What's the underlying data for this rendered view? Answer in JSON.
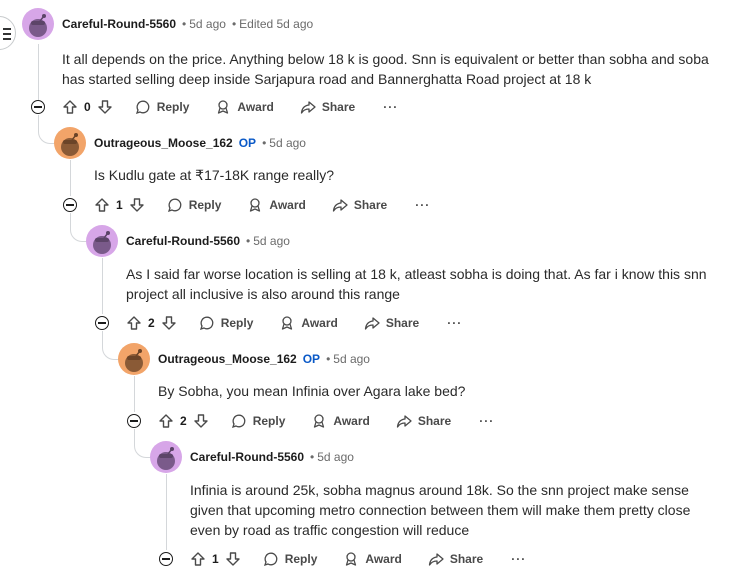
{
  "comments": [
    {
      "author": "Careful-Round-5560",
      "op": false,
      "time": "5d ago",
      "edited": "Edited 5d ago",
      "body": "It all depends on the price. Anything below 18 k is good. Snn is equivalent or better than sobha and soba has started selling deep inside Sarjapura road and Bannerghatta Road project at 18 k",
      "votes": "0",
      "avatar_color": "#d7a6e8"
    },
    {
      "author": "Outrageous_Moose_162",
      "op_label": "OP",
      "time": "5d ago",
      "body": "Is Kudlu gate at ₹17-18K range really?",
      "votes": "1",
      "avatar_color": "#f2a469"
    },
    {
      "author": "Careful-Round-5560",
      "time": "5d ago",
      "body": "As I said far worse location is selling at 18 k, atleast sobha is doing that. As far i know this snn project all inclusive is also around this range",
      "votes": "2",
      "avatar_color": "#d7a6e8"
    },
    {
      "author": "Outrageous_Moose_162",
      "op_label": "OP",
      "time": "5d ago",
      "body": "By Sobha, you mean Infinia over Agara lake bed?",
      "votes": "2",
      "avatar_color": "#f2a469"
    },
    {
      "author": "Careful-Round-5560",
      "time": "5d ago",
      "body": "Infinia is around 25k, sobha magnus around 18k. So the snn project make sense given that upcoming metro connection between them will make them pretty close even by road as traffic congestion will reduce",
      "votes": "1",
      "avatar_color": "#d7a6e8"
    }
  ],
  "actions": {
    "reply": "Reply",
    "award": "Award",
    "share": "Share",
    "more": "···"
  },
  "separator": "•"
}
